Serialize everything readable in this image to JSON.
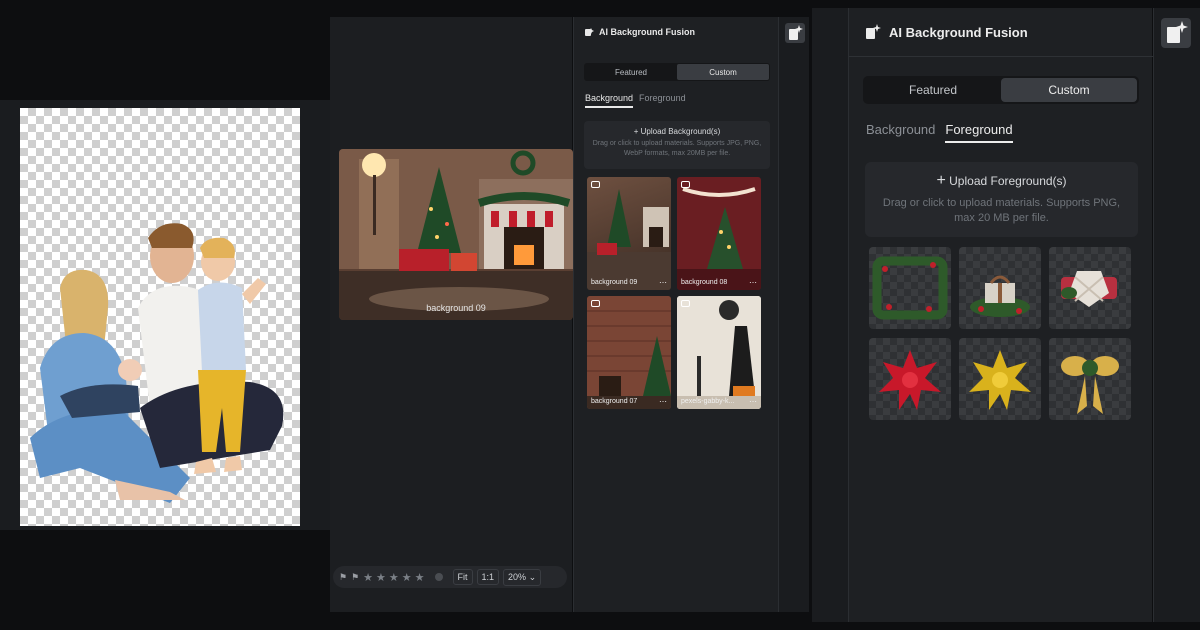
{
  "panel": {
    "title": "AI Background Fusion",
    "modes": [
      "Featured",
      "Custom"
    ],
    "active_mode": "Custom"
  },
  "small_panel": {
    "tabs": {
      "background": "Background",
      "foreground": "Foreground",
      "active": "Background"
    },
    "upload": {
      "label": "Upload Background(s)",
      "desc": "Drag or click to upload materials. Supports JPG, PNG, WebP formats, max 20MB per file."
    },
    "thumbnails": [
      {
        "caption": "background 09"
      },
      {
        "caption": "background 08"
      },
      {
        "caption": "background 07"
      },
      {
        "caption": "pexels-gabby-k..."
      }
    ]
  },
  "large_panel": {
    "tabs": {
      "background": "Background",
      "foreground": "Foreground",
      "active": "Foreground"
    },
    "upload": {
      "label": "Upload Foreground(s)",
      "desc": "Drag or click to upload materials. Supports PNG, max 20 MB per file."
    },
    "stickers": [
      "wreath",
      "gift-box",
      "heart-gift",
      "red-bow",
      "gold-bow",
      "gold-ribbon-bow"
    ]
  },
  "editor": {
    "preview_caption": "background 09",
    "fit_label": "Fit",
    "one_to_one_label": "1:1",
    "zoom": "20%",
    "rating": 0
  },
  "icons": {
    "more": "⋯",
    "plus": "+",
    "chevron": "⌄",
    "star": "★",
    "flag": "⚑"
  }
}
